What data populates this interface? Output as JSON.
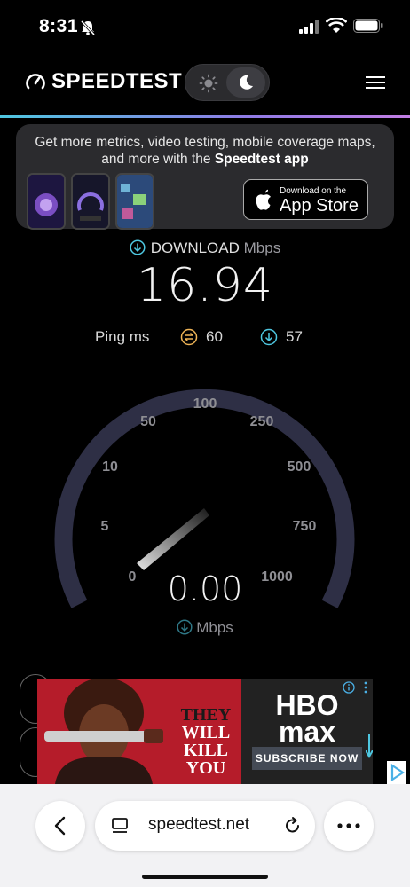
{
  "status_bar": {
    "time": "8:31"
  },
  "header": {
    "brand": "SPEEDTEST"
  },
  "promo": {
    "line1": "Get more metrics, video testing, mobile coverage maps,",
    "line2_prefix": "and more with the ",
    "line2_bold": "Speedtest app",
    "appstore_small": "Download on the",
    "appstore_big": "App Store"
  },
  "download": {
    "label": "DOWNLOAD",
    "unit": "Mbps",
    "value": "16.94"
  },
  "ping": {
    "label": "Ping ms",
    "idle": "60",
    "download": "57"
  },
  "gauge": {
    "ticks": [
      "0",
      "5",
      "10",
      "50",
      "100",
      "250",
      "500",
      "750",
      "1000"
    ],
    "value": "0.00",
    "unit": "Mbps"
  },
  "ad": {
    "headline_1": "THEY",
    "headline_2": "WILL",
    "headline_3": "KILL",
    "headline_4": "YOU",
    "brand_1": "HBO",
    "brand_2": "max",
    "cta": "SUBSCRIBE NOW"
  },
  "browser": {
    "url": "speedtest.net"
  },
  "colors": {
    "accent_cyan": "#4ec7e0",
    "accent_purple": "#c27ee4",
    "gauge_track": "#2e2f45",
    "ping_idle": "#f0b557"
  }
}
